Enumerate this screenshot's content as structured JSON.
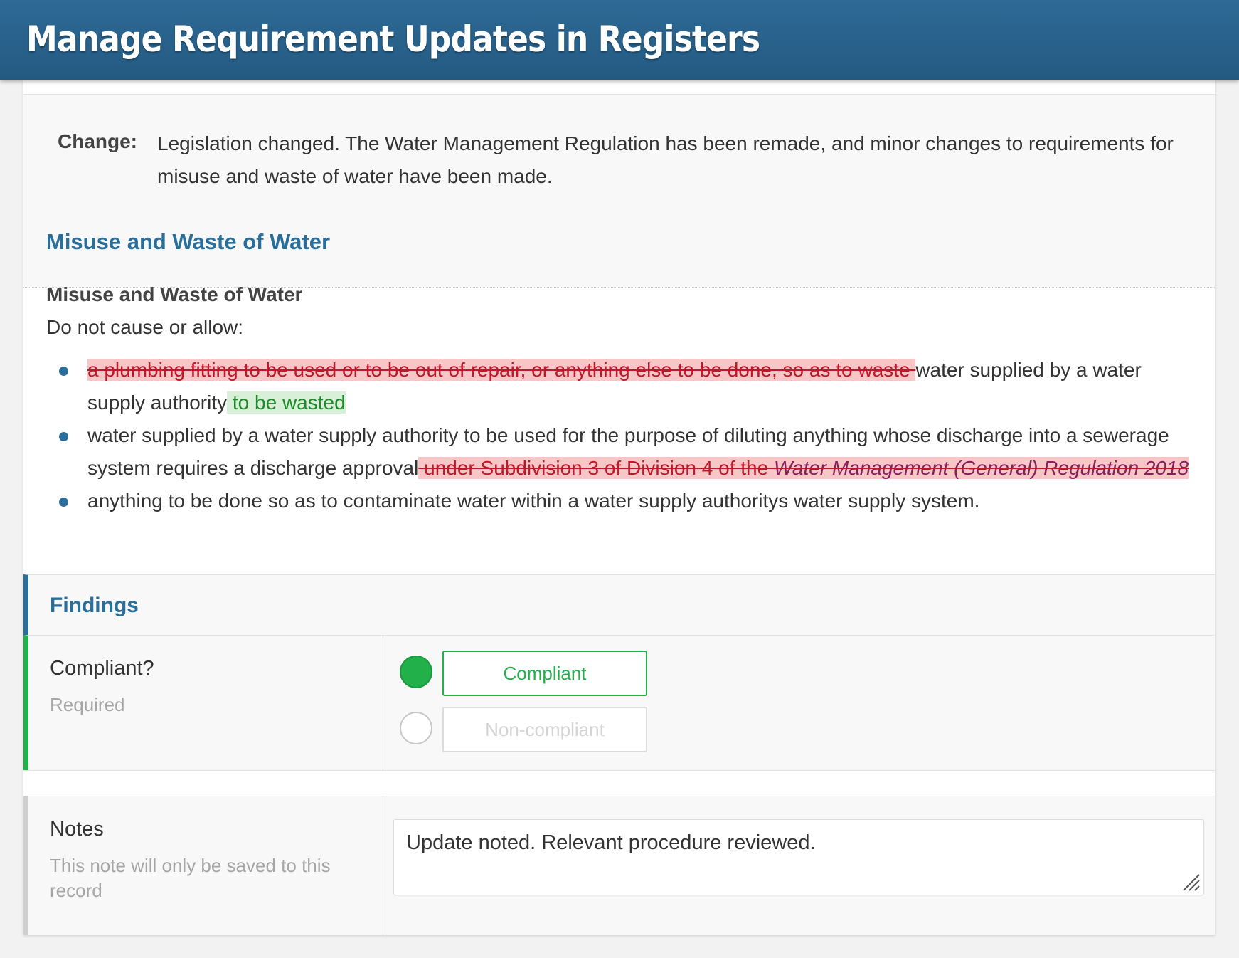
{
  "header": {
    "title": "Manage Requirement Updates in Registers"
  },
  "change": {
    "label": "Change:",
    "text": "Legislation changed. The Water Management Regulation has been remade, and minor changes to requirements for misuse and waste of water have been made."
  },
  "requirement": {
    "title": "Misuse and Waste of Water",
    "subtitle": "Misuse and Waste of Water",
    "lead": "Do not cause or allow:",
    "items": [
      {
        "deleted": "a plumbing fitting to be used or to be out of repair, or anything else to be done, so as to waste ",
        "text": "water supplied by a water supply authority",
        "inserted": " to be wasted"
      },
      {
        "text": "water supplied by a water supply authority to be used for the purpose of diluting anything whose discharge into a sewerage system requires a discharge approval",
        "deleted": " under Subdivision 3 of Division 4 of the ",
        "deleted_italic": "Water Management (General) Regulation 2018"
      },
      {
        "text": "anything to be done so as to contaminate water within a water supply authoritys water supply system."
      }
    ]
  },
  "findings": {
    "title": "Findings",
    "compliant": {
      "label": "Compliant?",
      "hint": "Required",
      "options": [
        "Compliant",
        "Non-compliant"
      ],
      "selected": "Compliant"
    },
    "notes": {
      "label": "Notes",
      "hint": "This note will only be saved to this record",
      "value": "Update noted. Relevant procedure reviewed."
    }
  },
  "colors": {
    "header": "#2a6a95",
    "accent": "#2a6f9b",
    "compliant_green": "#22b04b",
    "deleted_bg": "#f8c6c6",
    "inserted_bg": "#d8f0d8"
  }
}
